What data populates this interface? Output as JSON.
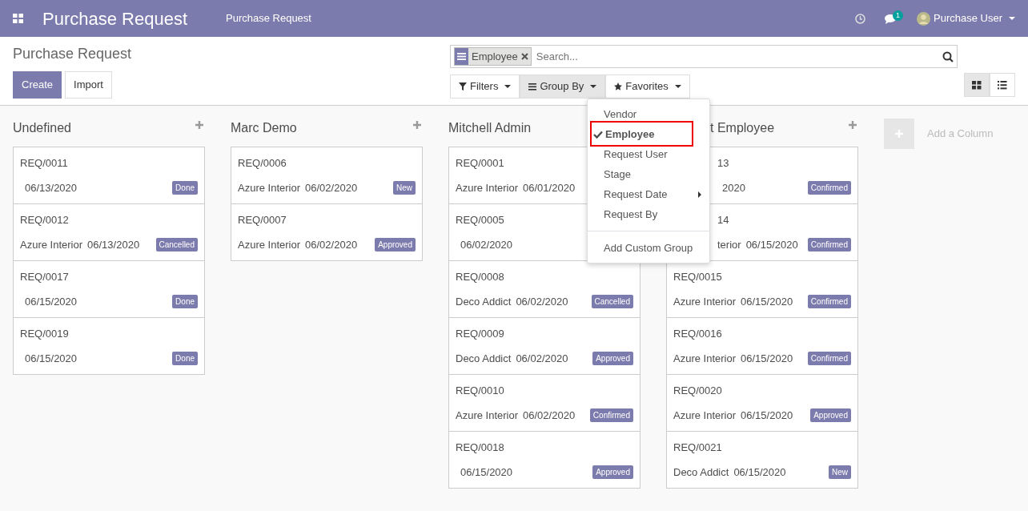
{
  "navbar": {
    "app_title": "Purchase Request",
    "menu": [
      "Purchase Request"
    ],
    "chat_count": "1",
    "user": "Purchase User"
  },
  "breadcrumb": "Purchase Request",
  "buttons": [
    "Create",
    "Import"
  ],
  "search": {
    "facets": [
      {
        "label": "Employee"
      }
    ],
    "placeholder": "Search..."
  },
  "filter_buttons": [
    {
      "label": "Filters",
      "kind": "filter",
      "selected": false
    },
    {
      "label": "Group By",
      "kind": "groupby",
      "selected": true
    },
    {
      "label": "Favorites",
      "kind": "favorites",
      "selected": false
    }
  ],
  "views": [
    {
      "kind": "kanban",
      "selected": true
    },
    {
      "kind": "list",
      "selected": false
    }
  ],
  "groupby_menu": {
    "items": [
      {
        "label": "Vendor",
        "selected": false,
        "submenu": false
      },
      {
        "label": "Employee",
        "selected": true,
        "submenu": false
      },
      {
        "label": "Request User",
        "selected": false,
        "submenu": false
      },
      {
        "label": "Stage",
        "selected": false,
        "submenu": false
      },
      {
        "label": "Request Date",
        "selected": false,
        "submenu": true
      },
      {
        "label": "Request By",
        "selected": false,
        "submenu": false
      }
    ],
    "custom": "Add Custom Group"
  },
  "columns": [
    {
      "title": "Undefined",
      "add_icon": true,
      "cards": [
        {
          "ref": "REQ/0011",
          "date": "06/13/2020",
          "status": "Done"
        },
        {
          "ref": "REQ/0012",
          "vendor": "Azure Interior",
          "date": "06/13/2020",
          "status": "Cancelled"
        },
        {
          "ref": "REQ/0017",
          "date": "06/15/2020",
          "status": "Done"
        },
        {
          "ref": "REQ/0019",
          "date": "06/15/2020",
          "status": "Done"
        }
      ]
    },
    {
      "title": "Marc Demo",
      "add_icon": true,
      "cards": [
        {
          "ref": "REQ/0006",
          "vendor": "Azure Interior",
          "date": "06/02/2020",
          "status": "New"
        },
        {
          "ref": "REQ/0007",
          "vendor": "Azure Interior",
          "date": "06/02/2020",
          "status": "Approved"
        }
      ]
    },
    {
      "title": "Mitchell Admin",
      "cards": [
        {
          "ref": "REQ/0001",
          "vendor": "Azure Interior",
          "date": "06/01/2020"
        },
        {
          "ref": "REQ/0005",
          "date": "06/02/2020"
        },
        {
          "ref": "REQ/0008",
          "vendor": "Deco Addict",
          "date": "06/02/2020",
          "status": "Cancelled"
        },
        {
          "ref": "REQ/0009",
          "vendor": "Deco Addict",
          "date": "06/02/2020",
          "status": "Approved"
        },
        {
          "ref": "REQ/0010",
          "vendor": "Azure Interior",
          "date": "06/02/2020",
          "status": "Confirmed"
        },
        {
          "ref": "REQ/0018",
          "date": "06/15/2020",
          "status": "Approved"
        }
      ]
    },
    {
      "title": "t Employee",
      "add_icon": true,
      "cards": [
        {
          "ref": "13",
          "date": "2020",
          "status": "Confirmed"
        },
        {
          "ref": "14",
          "vendor": "terior",
          "date": "06/15/2020",
          "status": "Confirmed"
        },
        {
          "ref": "REQ/0015",
          "vendor": "Azure Interior",
          "date": "06/15/2020",
          "status": "Confirmed"
        },
        {
          "ref": "REQ/0016",
          "vendor": "Azure Interior",
          "date": "06/15/2020",
          "status": "Confirmed"
        },
        {
          "ref": "REQ/0020",
          "vendor": "Azure Interior",
          "date": "06/15/2020",
          "status": "Approved"
        },
        {
          "ref": "REQ/0021",
          "vendor": "Deco Addict",
          "date": "06/15/2020",
          "status": "New"
        }
      ]
    }
  ],
  "add_column": "Add a Column"
}
